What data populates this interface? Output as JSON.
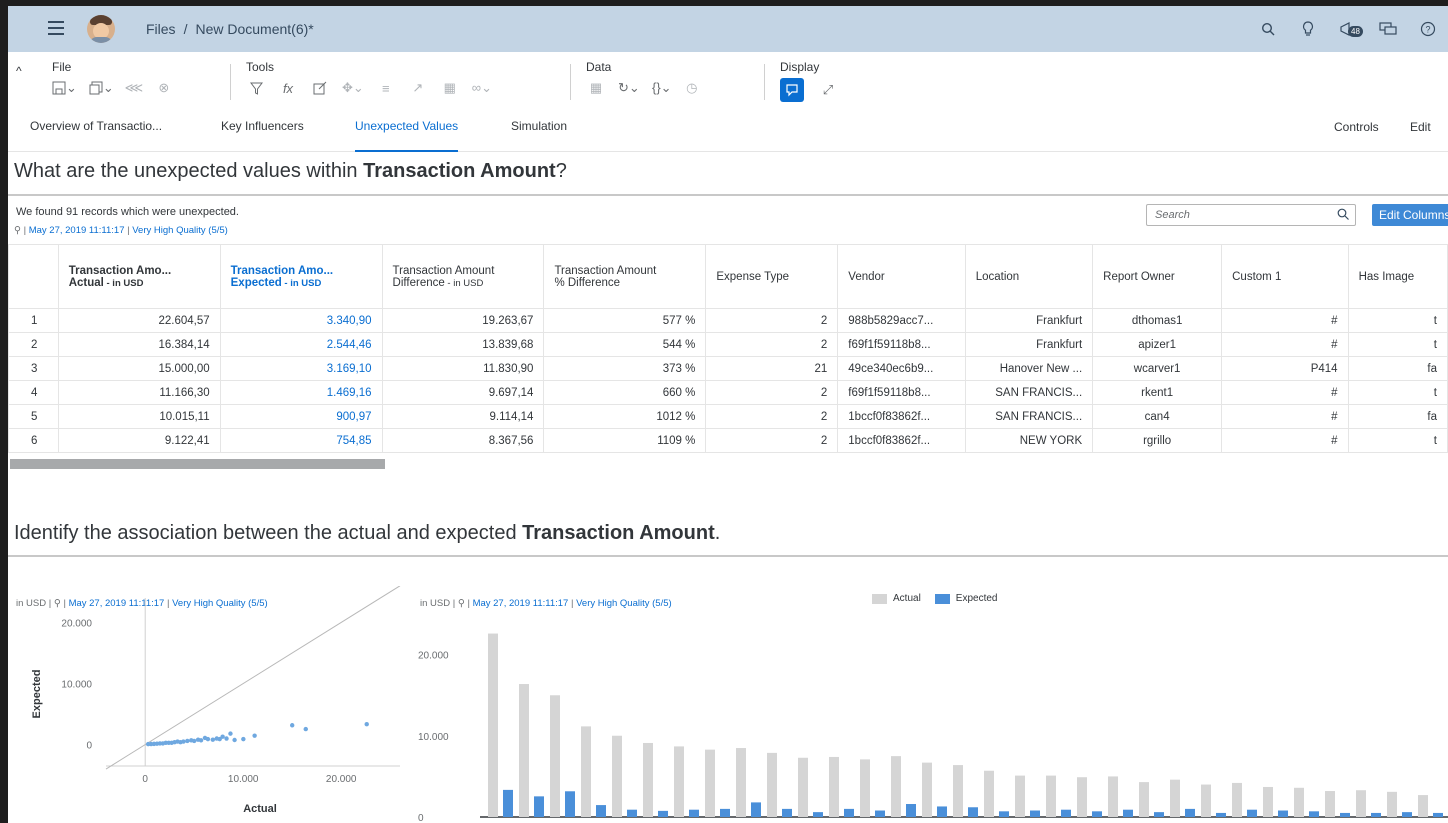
{
  "shell": {
    "breadcrumb_root": "Files",
    "breadcrumb_sep": "/",
    "document": "New Document(6)*",
    "notif_count": "48"
  },
  "toolbar": {
    "file_label": "File",
    "tools_label": "Tools",
    "data_label": "Data",
    "display_label": "Display",
    "controls": "Controls",
    "edit": "Edit"
  },
  "tabs": [
    "Overview of Transactio",
    "Key Influencers",
    "Unexpected Values",
    "Simulation"
  ],
  "section1": {
    "title_pre": "What are the unexpected values within ",
    "title_bold": "Transaction Amount",
    "title_post": "?",
    "found": "We found 91 records which were unexpected.",
    "date": "May 27, 2019 11:11:17",
    "quality": "Very High Quality (5/5)",
    "search_placeholder": "Search",
    "edit_columns": "Edit Columns"
  },
  "table": {
    "headers": [
      {
        "l1": "Transaction Amo...",
        "l2": "Actual",
        "unit": " - in USD"
      },
      {
        "l1": "Transaction Amo...",
        "l2": "Expected",
        "unit": " - in USD"
      },
      {
        "l1": "Transaction Amount",
        "l2": "Difference",
        "unit": " - in USD"
      },
      {
        "l1": "Transaction Amount",
        "l2": "% Difference",
        "unit": ""
      },
      {
        "l1": "Expense Type"
      },
      {
        "l1": "Vendor"
      },
      {
        "l1": "Location"
      },
      {
        "l1": "Report Owner"
      },
      {
        "l1": "Custom 1"
      },
      {
        "l1": "Has Image"
      }
    ],
    "rows": [
      [
        "1",
        "22.604,57",
        "3.340,90",
        "19.263,67",
        "577 %",
        "2",
        "988b5829acc7...",
        "Frankfurt",
        "dthomas1",
        "#",
        "t"
      ],
      [
        "2",
        "16.384,14",
        "2.544,46",
        "13.839,68",
        "544 %",
        "2",
        "f69f1f59118b8...",
        "Frankfurt",
        "apizer1",
        "#",
        "t"
      ],
      [
        "3",
        "15.000,00",
        "3.169,10",
        "11.830,90",
        "373 %",
        "21",
        "49ce340ec6b9...",
        "Hanover New ...",
        "wcarver1",
        "P414",
        "fa"
      ],
      [
        "4",
        "11.166,30",
        "1.469,16",
        "9.697,14",
        "660 %",
        "2",
        "f69f1f59118b8...",
        "SAN FRANCIS...",
        "rkent1",
        "#",
        "t"
      ],
      [
        "5",
        "10.015,11",
        "900,97",
        "9.114,14",
        "1012 %",
        "2",
        "1bccf0f83862f...",
        "SAN FRANCIS...",
        "can4",
        "#",
        "fa"
      ],
      [
        "6",
        "9.122,41",
        "754,85",
        "8.367,56",
        "1109 %",
        "2",
        "1bccf0f83862f...",
        "NEW YORK",
        "rgrillo",
        "#",
        "t"
      ]
    ]
  },
  "section2": {
    "title_pre": "Identify the association between the actual and expected ",
    "title_bold": "Transaction Amount",
    "title_post": ".",
    "unit": "in USD",
    "date": "May 27, 2019 11:11:17",
    "quality": "Very High Quality (5/5)"
  },
  "chart_data": [
    {
      "type": "scatter",
      "xlabel": "Actual",
      "ylabel": "Expected",
      "xticks": [
        "0",
        "10.000",
        "20.000"
      ],
      "yticks": [
        "0",
        "10.000",
        "20.000"
      ],
      "xlim": [
        -4000,
        26000
      ],
      "ylim": [
        -3500,
        24000
      ],
      "reference_line": "y = x",
      "points": [
        [
          22605,
          3341
        ],
        [
          16384,
          2544
        ],
        [
          15000,
          3169
        ],
        [
          11166,
          1469
        ],
        [
          10015,
          901
        ],
        [
          9122,
          755
        ],
        [
          8700,
          1800
        ],
        [
          8300,
          1000
        ],
        [
          7900,
          1300
        ],
        [
          7600,
          900
        ],
        [
          7300,
          1000
        ],
        [
          6900,
          800
        ],
        [
          6400,
          900
        ],
        [
          6100,
          1100
        ],
        [
          5700,
          700
        ],
        [
          5400,
          800
        ],
        [
          5000,
          600
        ],
        [
          4700,
          700
        ],
        [
          4300,
          600
        ],
        [
          3900,
          500
        ],
        [
          3600,
          400
        ],
        [
          3300,
          500
        ],
        [
          3000,
          400
        ],
        [
          2700,
          300
        ],
        [
          2400,
          300
        ],
        [
          2100,
          300
        ],
        [
          1800,
          200
        ],
        [
          1500,
          200
        ],
        [
          1200,
          150
        ],
        [
          900,
          120
        ],
        [
          600,
          100
        ],
        [
          300,
          80
        ]
      ],
      "grid": false
    },
    {
      "type": "bar",
      "legend": [
        "Actual",
        "Expected"
      ],
      "legend_position": "top",
      "yticks": [
        "0",
        "10.000",
        "20.000"
      ],
      "ylim": [
        0,
        26000
      ],
      "series": [
        {
          "name": "Actual",
          "color": "#d5d5d5",
          "values": [
            22605,
            16384,
            15000,
            11166,
            10015,
            9122,
            8700,
            8300,
            8500,
            7900,
            7300,
            7400,
            7100,
            7500,
            6700,
            6400,
            5700,
            5100,
            5100,
            4900,
            5000,
            4300,
            4600,
            4000,
            4200,
            3700,
            3600,
            3200,
            3300,
            3100,
            2700
          ]
        },
        {
          "name": "Expected",
          "color": "#4a8fd9",
          "values": [
            3341,
            2544,
            3169,
            1469,
            901,
            755,
            900,
            1000,
            1800,
            1000,
            600,
            1000,
            800,
            1600,
            1300,
            1200,
            700,
            800,
            900,
            700,
            900,
            600,
            1000,
            500,
            900,
            800,
            700,
            500,
            500,
            600,
            500
          ]
        }
      ]
    }
  ]
}
